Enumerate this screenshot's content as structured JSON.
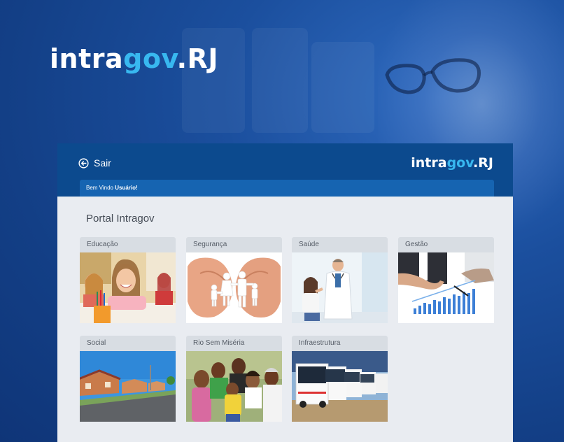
{
  "brand": {
    "word_white": "intra",
    "word_cyan": "gov",
    "suffix": ".RJ"
  },
  "header": {
    "logout_label": "Sair",
    "welcome_prefix": "Bem Vindo ",
    "welcome_user": "Usuário!"
  },
  "main": {
    "title": "Portal Intragov",
    "cards": [
      {
        "label": "Educação",
        "image": "children-classroom-photo"
      },
      {
        "label": "Segurança",
        "image": "hands-paper-family-photo"
      },
      {
        "label": "Saúde",
        "image": "doctor-child-photo"
      },
      {
        "label": "Gestão",
        "image": "business-charts-photo"
      },
      {
        "label": "Social",
        "image": "housing-street-photo"
      },
      {
        "label": "Rio Sem Miséria",
        "image": "happy-family-photo"
      },
      {
        "label": "Infraestrutura",
        "image": "bus-fleet-photo"
      }
    ]
  },
  "colors": {
    "background": "#133f86",
    "header": "#0c4a8e",
    "welcome_bar": "#1664b1",
    "content": "#e9ecf1",
    "card_label": "#d8dde3",
    "brand_accent": "#38b8f0"
  }
}
